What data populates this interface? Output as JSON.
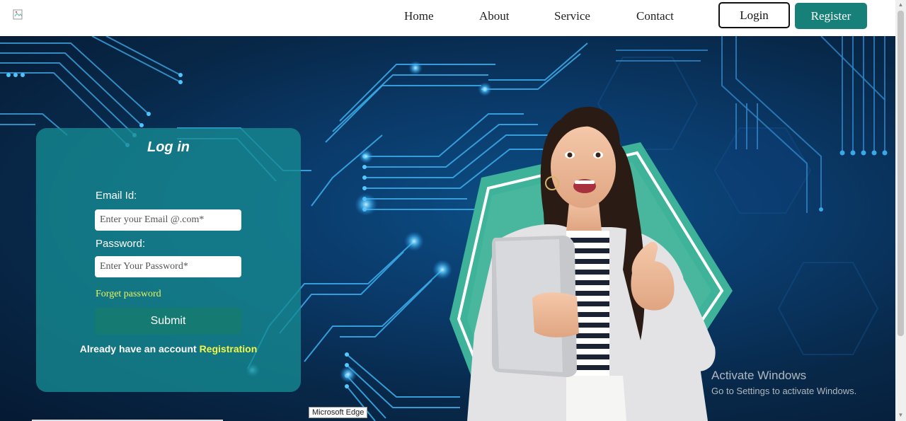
{
  "nav": {
    "logo_icon": "broken-image-icon",
    "links": [
      "Home",
      "About",
      "Service",
      "Contact"
    ],
    "login_label": "Login",
    "register_label": "Register"
  },
  "login_form": {
    "title": "Log in",
    "email_label": "Email Id:",
    "email_placeholder": "Enter your Email @.com*",
    "email_value": "",
    "password_label": "Password:",
    "password_placeholder": "Enter Your Password*",
    "password_value": "",
    "forget_label": "Forget password",
    "submit_label": "Submit",
    "already_text": "Already have an account ",
    "registration_link": "Registration"
  },
  "watermark": {
    "line1": "Activate Windows",
    "line2": "Go to Settings to activate Windows."
  },
  "tooltip": "Microsoft Edge",
  "colors": {
    "brand": "#178079",
    "card": "#168c94",
    "link_highlight": "#f3f54a",
    "hero_dark": "#082849"
  }
}
